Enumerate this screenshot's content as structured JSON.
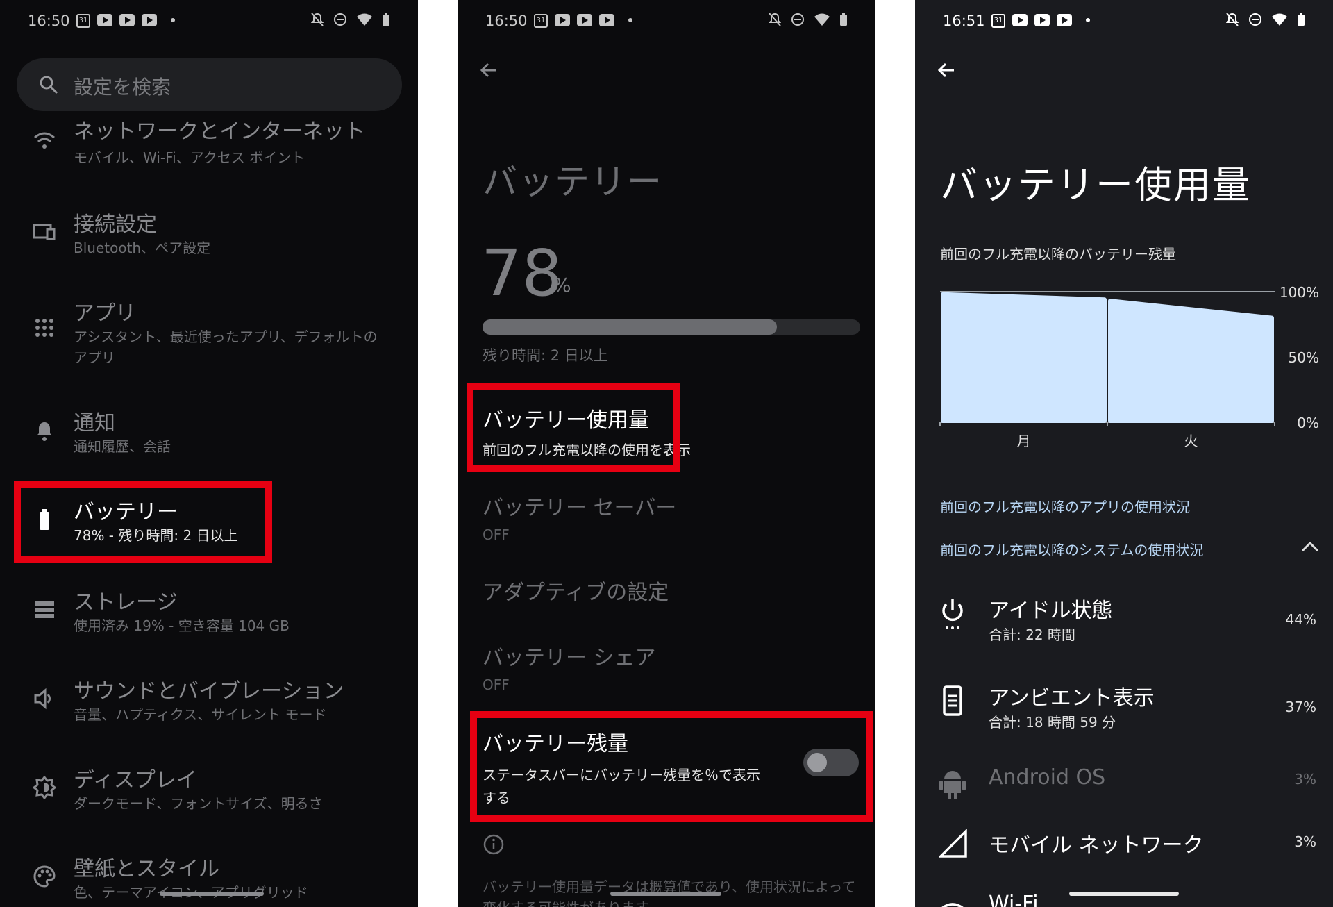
{
  "screen1": {
    "status": {
      "time": "16:50",
      "calendar_day": "31"
    },
    "search": {
      "placeholder": "設定を検索"
    },
    "items": [
      {
        "title": "ネットワークとインターネット",
        "sub": "モバイル、Wi-Fi、アクセス ポイント",
        "icon": "wifi-icon"
      },
      {
        "title": "接続設定",
        "sub": "Bluetooth、ペア設定",
        "icon": "devices-icon"
      },
      {
        "title": "アプリ",
        "sub": "アシスタント、最近使ったアプリ、デフォルトの",
        "sub2": "アプリ",
        "icon": "apps-grid-icon"
      },
      {
        "title": "通知",
        "sub": "通知履歴、会話",
        "icon": "bell-icon"
      },
      {
        "title": "バッテリー",
        "sub": "78% - 残り時間: 2 日以上",
        "icon": "battery-icon"
      },
      {
        "title": "ストレージ",
        "sub": "使用済み 19% - 空き容量 104 GB",
        "icon": "storage-icon"
      },
      {
        "title": "サウンドとバイブレーション",
        "sub": "音量、ハプティクス、サイレント モード",
        "icon": "speaker-icon"
      },
      {
        "title": "ディスプレイ",
        "sub": "ダークモード、フォントサイズ、明るさ",
        "icon": "brightness-icon"
      },
      {
        "title": "壁紙とスタイル",
        "sub": "色、テーマアイコン、アプリグリッド",
        "icon": "palette-icon"
      }
    ]
  },
  "screen2": {
    "status": {
      "time": "16:50",
      "calendar_day": "31"
    },
    "title": "バッテリー",
    "level": {
      "value": "78",
      "unit": "%",
      "fraction": 0.78
    },
    "remaining": "残り時間: 2 日以上",
    "items": [
      {
        "title": "バッテリー使用量",
        "sub": "前回のフル充電以降の使用を表示"
      },
      {
        "title": "バッテリー セーバー",
        "sub": "OFF"
      },
      {
        "title": "アダプティブの設定",
        "sub": ""
      },
      {
        "title": "バッテリー シェア",
        "sub": "OFF"
      },
      {
        "title": "バッテリー残量",
        "sub": "ステータスバーにバッテリー残量を％で表示",
        "sub2": "する",
        "toggle": false
      }
    ],
    "footnote": "バッテリー使用量データは概算値であり、使用状況によって変化する可能性があります"
  },
  "screen3": {
    "status": {
      "time": "16:51",
      "calendar_day": "31"
    },
    "title": "バッテリー使用量",
    "chart_caption": "前回のフル充電以降のバッテリー残量",
    "chart_data": {
      "type": "area",
      "categories": [
        "月",
        "火"
      ],
      "y_tick_labels": [
        "100%",
        "50%",
        "0%"
      ],
      "ylim": [
        0,
        100
      ],
      "series": [
        {
          "values": [
            98,
            94
          ]
        },
        {
          "values": [
            93,
            80
          ]
        }
      ],
      "fill_color": "#cfe6ff",
      "grid": false
    },
    "section_apps": "前回のフル充電以降のアプリの使用状況",
    "section_system": "前回のフル充電以降のシステムの使用状況",
    "rows": [
      {
        "title": "アイドル状態",
        "sub": "合計: 22 時間",
        "pct": "44%",
        "icon": "power-icon"
      },
      {
        "title": "アンビエント表示",
        "sub": "合計: 18 時間 59 分",
        "pct": "37%",
        "icon": "phone-display-icon"
      },
      {
        "title": "Android OS",
        "sub": "",
        "pct": "3%",
        "icon": "android-icon"
      },
      {
        "title": "モバイル ネットワーク",
        "sub": "",
        "pct": "3%",
        "icon": "signal-icon"
      },
      {
        "title": "Wi-Fi",
        "sub": "",
        "pct": "",
        "icon": "wifi-icon"
      }
    ]
  }
}
